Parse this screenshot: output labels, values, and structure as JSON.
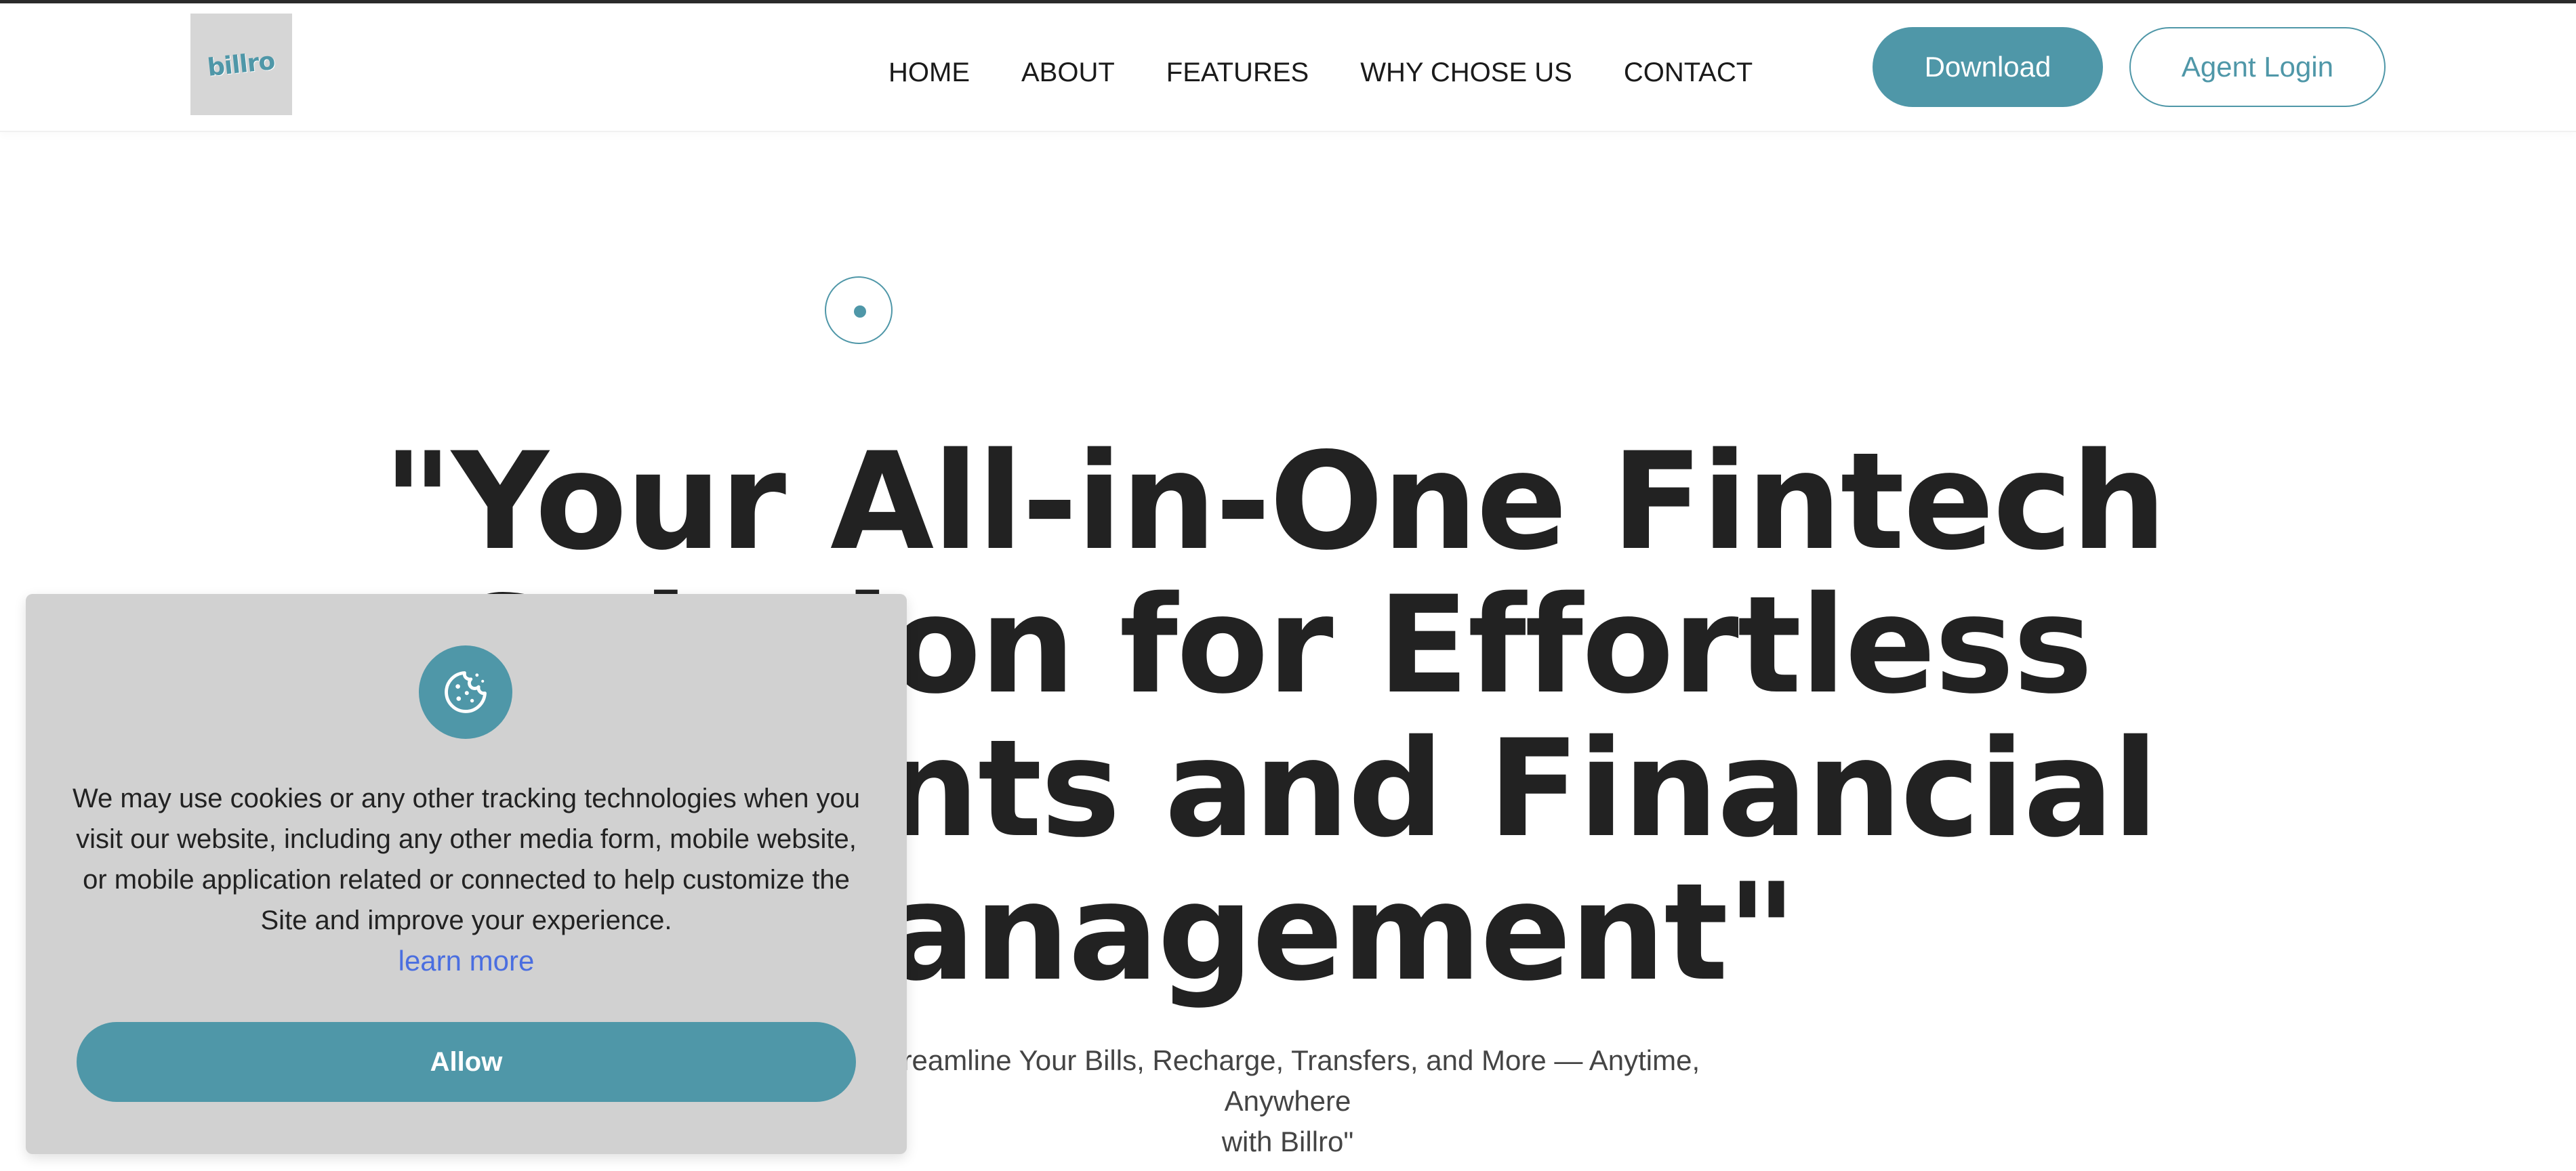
{
  "header": {
    "logo_text": "billro",
    "nav": [
      {
        "label": "HOME"
      },
      {
        "label": "ABOUT"
      },
      {
        "label": "FEATURES"
      },
      {
        "label": "WHY CHOSE US"
      },
      {
        "label": "CONTACT"
      }
    ],
    "download_label": "Download",
    "agent_login_label": "Agent Login"
  },
  "hero": {
    "title_lines": [
      "\"Your All-in-One Fintech",
      "Solution for Effortless",
      "Payments and Financial",
      "Management\""
    ],
    "subtitle_lines": [
      "Streamline Your Bills, Recharge, Transfers, and More — Anytime, Anywhere",
      "with Billro\""
    ]
  },
  "cookie_banner": {
    "icon": "cookie-icon",
    "text": "We may use cookies or any other tracking technologies when you visit our website, including any other media form, mobile website, or mobile application related or connected to help customize the Site and improve your experience.",
    "learn_more_label": "learn more",
    "allow_label": "Allow"
  },
  "colors": {
    "accent": "#4f97a8",
    "link": "#4a6ee0",
    "banner_bg": "#d1d1d1",
    "text_dark": "#222222"
  }
}
